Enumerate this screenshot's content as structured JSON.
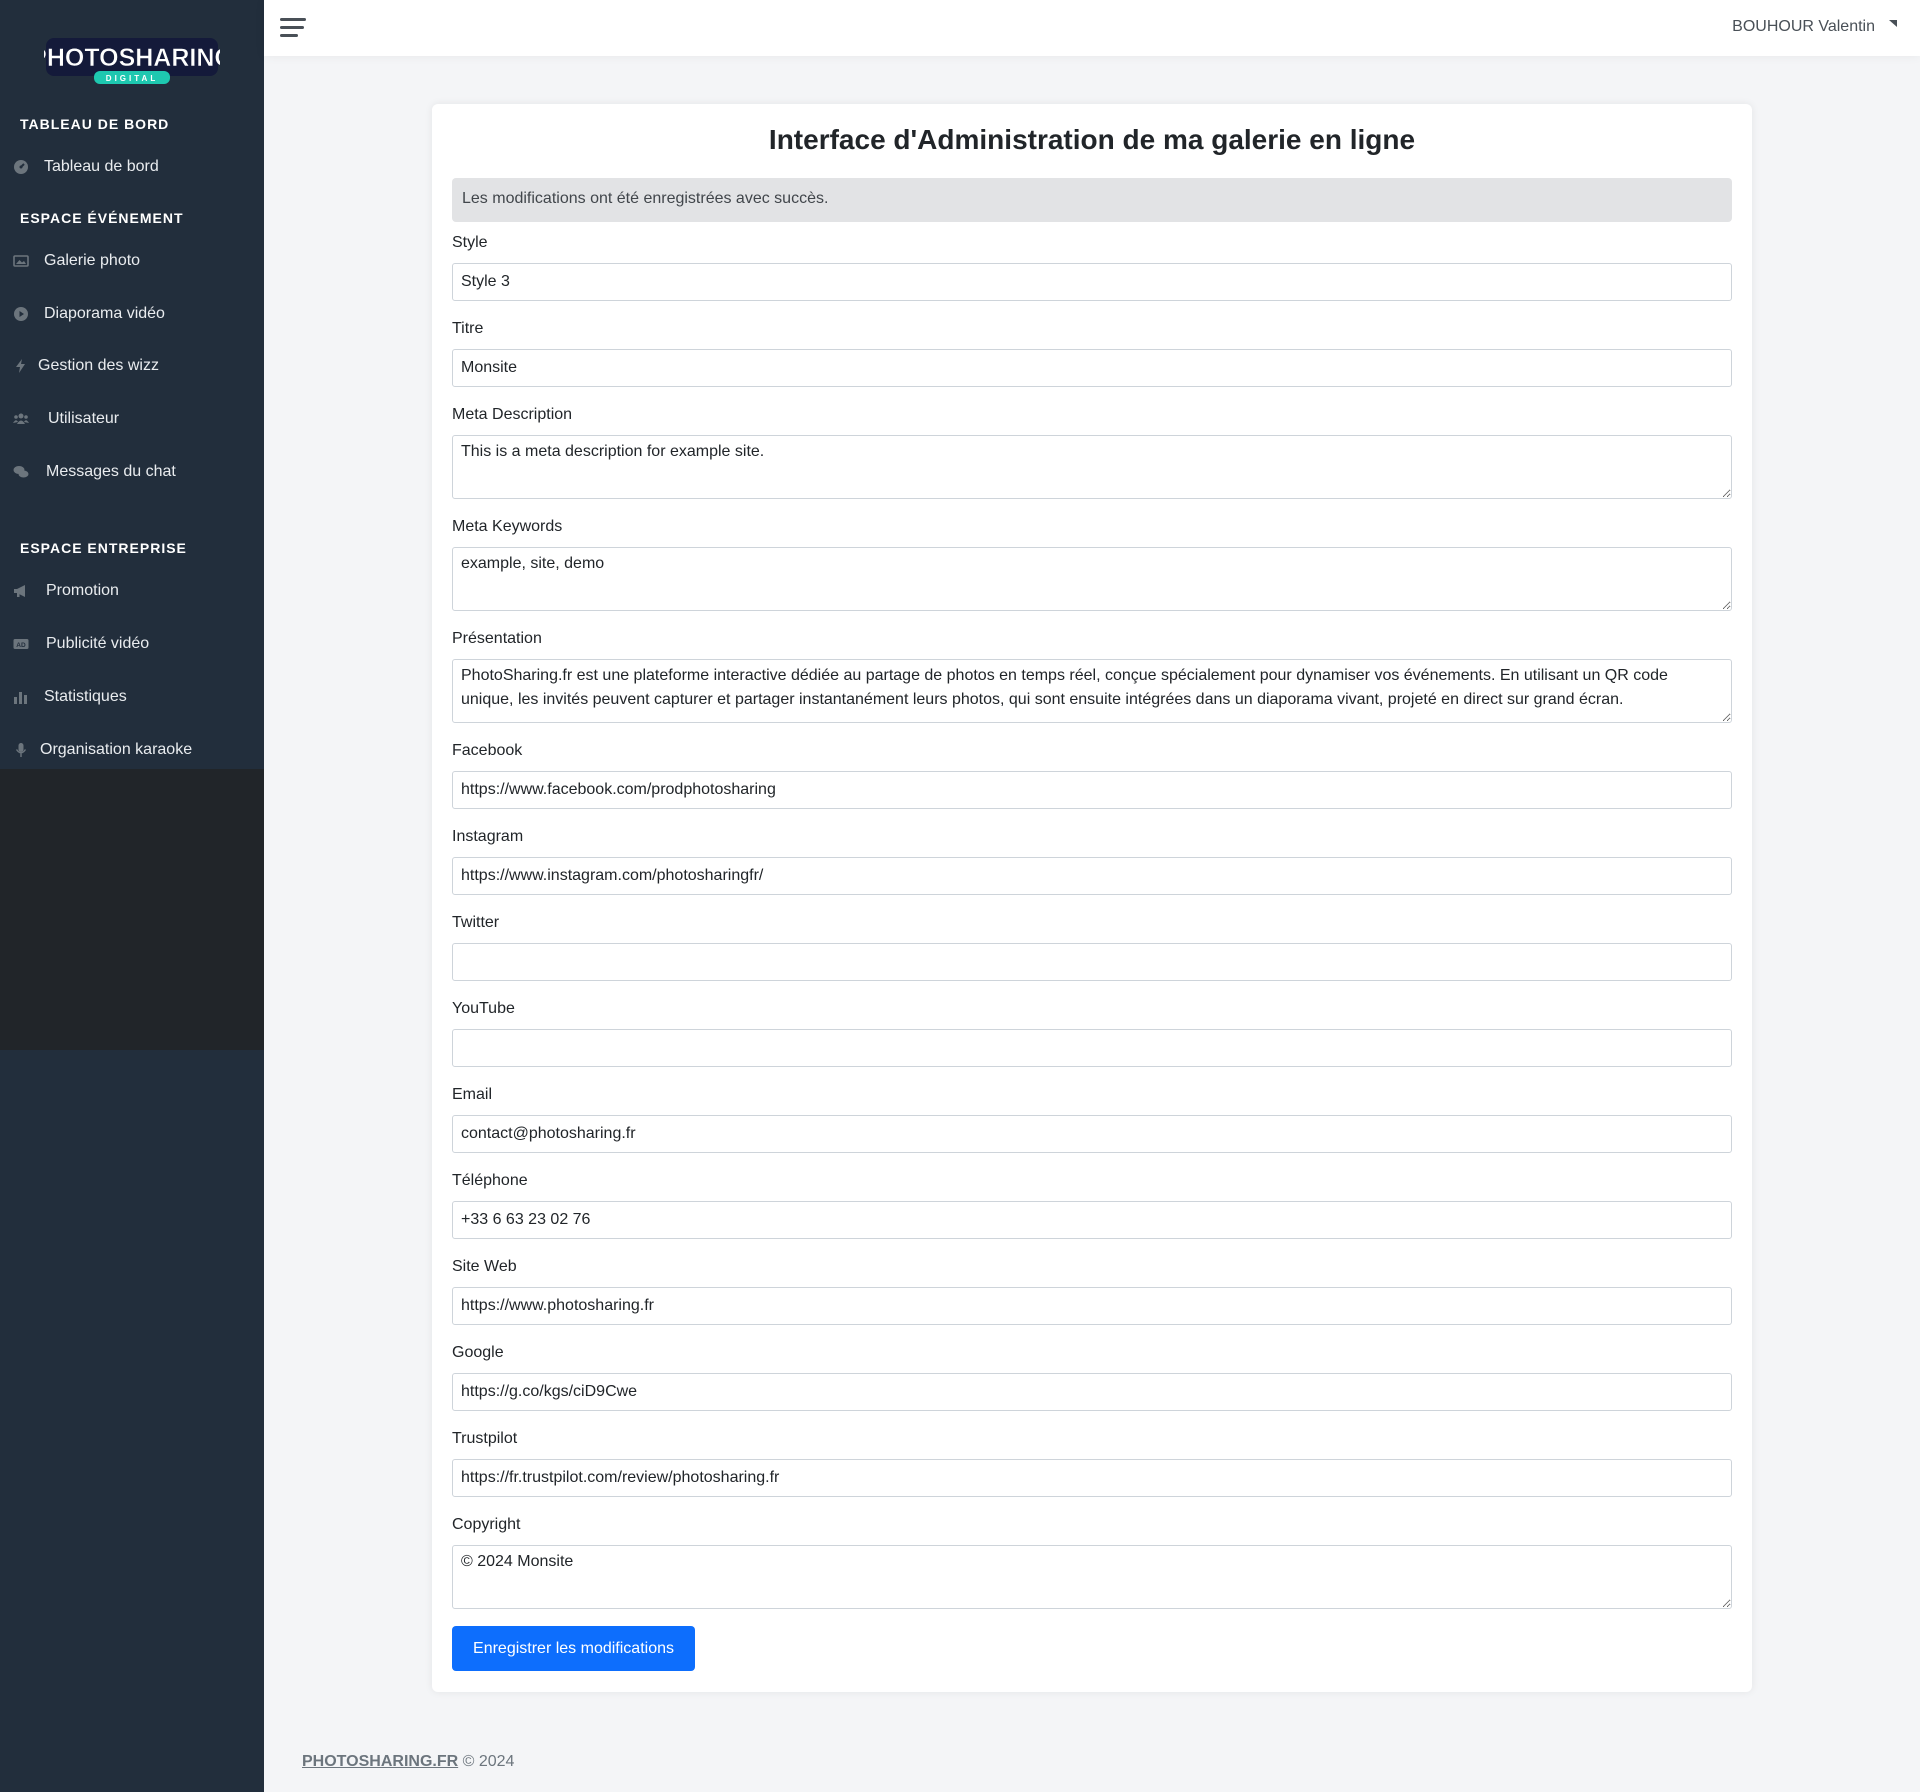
{
  "brand": {
    "name": "PHOTOSHARING",
    "sub": "DIGITAL"
  },
  "sidebar": {
    "sections": [
      {
        "header": "TABLEAU DE BORD",
        "items": [
          {
            "label": "Tableau de bord",
            "icon": "dashboard-icon"
          }
        ]
      },
      {
        "header": "ESPACE ÉVÉNEMENT",
        "items": [
          {
            "label": "Galerie photo",
            "icon": "image-icon"
          },
          {
            "label": "Diaporama vidéo",
            "icon": "play-circle-icon"
          },
          {
            "label": "Gestion des wizz",
            "icon": "bolt-icon"
          },
          {
            "label": "Utilisateur",
            "icon": "users-icon"
          },
          {
            "label": "Messages du chat",
            "icon": "chat-icon"
          }
        ]
      },
      {
        "header": "ESPACE ENTREPRISE",
        "items": [
          {
            "label": "Promotion",
            "icon": "megaphone-icon"
          },
          {
            "label": "Publicité vidéo",
            "icon": "ad-icon"
          },
          {
            "label": "Statistiques",
            "icon": "bar-chart-icon"
          },
          {
            "label": "Organisation karaoke",
            "icon": "microphone-icon"
          }
        ]
      }
    ]
  },
  "topbar": {
    "user": "BOUHOUR Valentin"
  },
  "main": {
    "title": "Interface d'Administration de ma galerie en ligne",
    "alert": "Les modifications ont été enregistrées avec succès.",
    "fields": {
      "style": {
        "label": "Style",
        "value": "Style 3"
      },
      "titre": {
        "label": "Titre",
        "value": "Monsite"
      },
      "meta_description": {
        "label": "Meta Description",
        "value": "This is a meta description for example site."
      },
      "meta_keywords": {
        "label": "Meta Keywords",
        "value": "example, site, demo"
      },
      "presentation": {
        "label": "Présentation",
        "value": "PhotoSharing.fr est une plateforme interactive dédiée au partage de photos en temps réel, conçue spécialement pour dynamiser vos événements. En utilisant un QR code unique, les invités peuvent capturer et partager instantanément leurs photos, qui sont ensuite intégrées dans un diaporama vivant, projeté en direct sur grand écran."
      },
      "facebook": {
        "label": "Facebook",
        "value": "https://www.facebook.com/prodphotosharing"
      },
      "instagram": {
        "label": "Instagram",
        "value": "https://www.instagram.com/photosharingfr/"
      },
      "twitter": {
        "label": "Twitter",
        "value": ""
      },
      "youtube": {
        "label": "YouTube",
        "value": ""
      },
      "email": {
        "label": "Email",
        "value": "contact@photosharing.fr"
      },
      "telephone": {
        "label": "Téléphone",
        "value": "+33 6 63 23 02 76"
      },
      "site_web": {
        "label": "Site Web",
        "value": "https://www.photosharing.fr"
      },
      "google": {
        "label": "Google",
        "value": "https://g.co/kgs/ciD9Cwe"
      },
      "trustpilot": {
        "label": "Trustpilot",
        "value": "https://fr.trustpilot.com/review/photosharing.fr"
      },
      "copyright": {
        "label": "Copyright",
        "value": "© 2024 Monsite"
      }
    },
    "submit_label": "Enregistrer les modifications"
  },
  "footer": {
    "link": "PHOTOSHARING.FR",
    "text": "© 2024"
  },
  "colors": {
    "sidebar": "#222e3c",
    "primary": "#0d6efd",
    "alert_bg": "#e2e3e5"
  }
}
